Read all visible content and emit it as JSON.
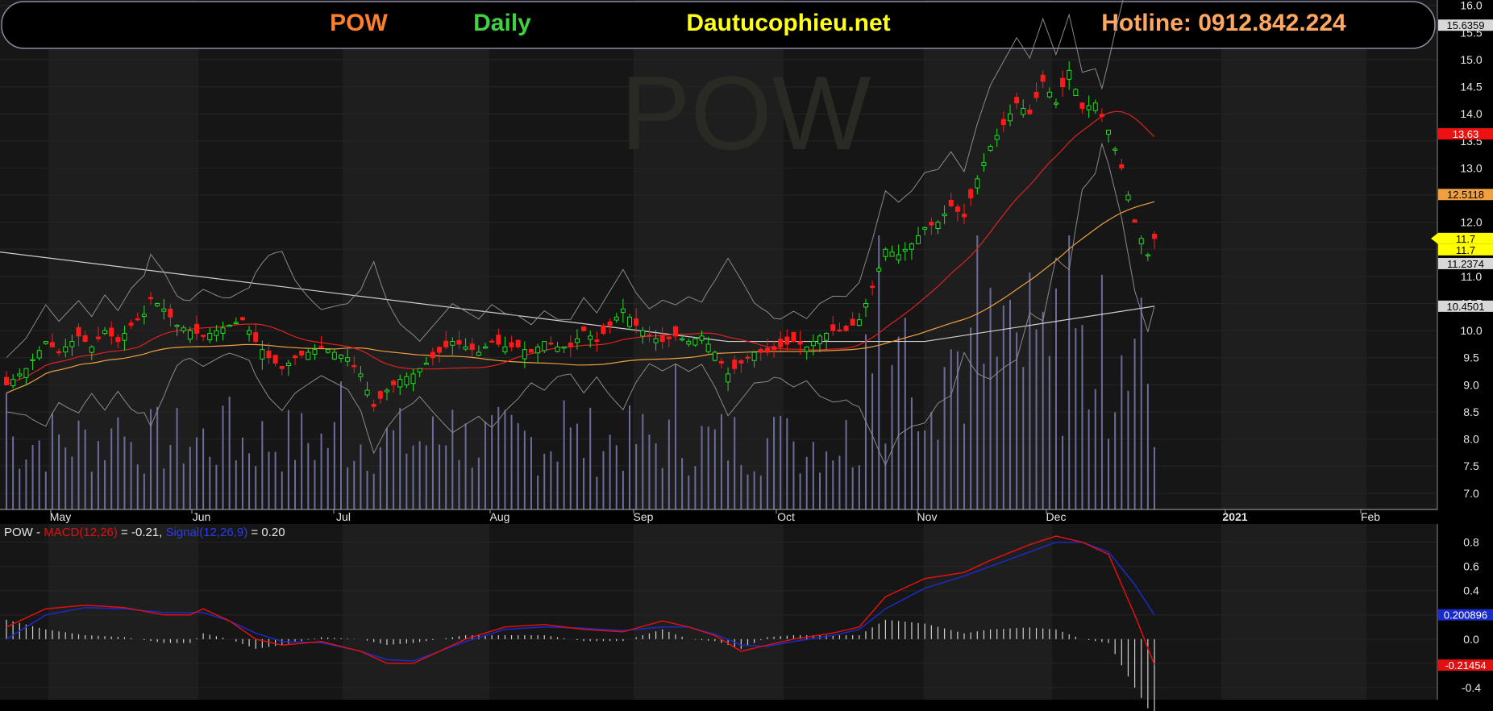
{
  "header": {
    "symbol": "POW",
    "period": "Daily",
    "site": "Dautucophieu.net",
    "hotline": "Hotline: 0912.842.224"
  },
  "colors": {
    "symbol": "#ff7f2a",
    "period": "#3fd13f",
    "site": "#ffff1a",
    "hotline": "#ffa860",
    "up_candle": "#22dd22",
    "down_candle": "#ff1a1a",
    "macd_line": "#e01010",
    "signal_line": "#1a2cc8",
    "volume": "#6c6c9a"
  },
  "watermark": "POW",
  "chart_data": [
    {
      "type": "candlestick",
      "ticker": "POW",
      "ylim": [
        6.7,
        16.1
      ],
      "y_ticks": [
        "7.0",
        "7.5",
        "8.0",
        "8.5",
        "9.0",
        "9.5",
        "10.0",
        "10.5",
        "11.0",
        "11.5",
        "12.0",
        "12.5",
        "13.0",
        "13.5",
        "14.0",
        "14.5",
        "15.0",
        "15.5",
        "16.0"
      ],
      "x_labels": [
        "May",
        "Jun",
        "Jul",
        "Aug",
        "Sep",
        "Oct",
        "Nov",
        "Dec",
        "2021",
        "Feb"
      ],
      "price_tags": [
        {
          "label": "15.6359",
          "value": 15.6359,
          "bg": "#d8d8d8",
          "fg": "#000000"
        },
        {
          "label": "13.63",
          "value": 13.63,
          "bg": "#ee1111",
          "fg": "#ffffff"
        },
        {
          "label": "12.5118",
          "value": 12.5118,
          "bg": "#f0a040",
          "fg": "#000000"
        },
        {
          "label": "11.7",
          "value": 11.7,
          "bg": "#ffff00",
          "fg": "#000000"
        },
        {
          "label": "11.7",
          "value": 11.7,
          "bg": "#ffff00",
          "fg": "#000000"
        },
        {
          "label": "11.2374",
          "value": 11.2374,
          "bg": "#d8d8d8",
          "fg": "#000000"
        },
        {
          "label": "10.4501",
          "value": 10.4501,
          "bg": "#d8d8d8",
          "fg": "#000000"
        }
      ],
      "ohlc_description": "Daily candles from late April 2020 to early Feb 2021",
      "close_path": [
        [
          0,
          9.0
        ],
        [
          3,
          9.3
        ],
        [
          6,
          9.8
        ],
        [
          8,
          9.6
        ],
        [
          11,
          9.9
        ],
        [
          13,
          9.7
        ],
        [
          15,
          10.0
        ],
        [
          17,
          9.8
        ],
        [
          19,
          10.1
        ],
        [
          21,
          10.3
        ],
        [
          22,
          10.6
        ],
        [
          24,
          10.4
        ],
        [
          26,
          10.1
        ],
        [
          28,
          10.0
        ],
        [
          30,
          9.9
        ],
        [
          32,
          10.0
        ],
        [
          34,
          10.1
        ],
        [
          36,
          10.2
        ],
        [
          38,
          9.8
        ],
        [
          40,
          9.5
        ],
        [
          42,
          9.3
        ],
        [
          44,
          9.5
        ],
        [
          46,
          9.6
        ],
        [
          48,
          9.7
        ],
        [
          50,
          9.6
        ],
        [
          52,
          9.5
        ],
        [
          54,
          9.2
        ],
        [
          56,
          8.6
        ],
        [
          58,
          8.9
        ],
        [
          60,
          9.1
        ],
        [
          62,
          9.2
        ],
        [
          64,
          9.4
        ],
        [
          66,
          9.6
        ],
        [
          68,
          9.8
        ],
        [
          70,
          9.7
        ],
        [
          72,
          9.6
        ],
        [
          74,
          9.8
        ],
        [
          76,
          9.7
        ],
        [
          78,
          9.7
        ],
        [
          80,
          9.6
        ],
        [
          82,
          9.8
        ],
        [
          84,
          9.7
        ],
        [
          86,
          9.7
        ],
        [
          88,
          10.0
        ],
        [
          90,
          9.8
        ],
        [
          92,
          10.1
        ],
        [
          94,
          10.4
        ],
        [
          96,
          10.1
        ],
        [
          98,
          9.9
        ],
        [
          100,
          9.8
        ],
        [
          102,
          9.9
        ],
        [
          104,
          9.8
        ],
        [
          106,
          9.9
        ],
        [
          108,
          9.6
        ],
        [
          110,
          9.2
        ],
        [
          112,
          9.4
        ],
        [
          114,
          9.6
        ],
        [
          116,
          9.6
        ],
        [
          118,
          9.7
        ],
        [
          120,
          9.8
        ],
        [
          122,
          9.7
        ],
        [
          124,
          9.9
        ],
        [
          126,
          10.0
        ],
        [
          128,
          10.0
        ],
        [
          130,
          10.2
        ],
        [
          132,
          10.8
        ],
        [
          134,
          11.5
        ],
        [
          136,
          11.4
        ],
        [
          138,
          11.6
        ],
        [
          140,
          11.9
        ],
        [
          142,
          12.0
        ],
        [
          144,
          12.3
        ],
        [
          146,
          12.1
        ],
        [
          148,
          12.8
        ],
        [
          150,
          13.4
        ],
        [
          152,
          13.8
        ],
        [
          154,
          14.2
        ],
        [
          156,
          14.0
        ],
        [
          158,
          14.6
        ],
        [
          160,
          14.2
        ],
        [
          162,
          14.8
        ],
        [
          164,
          14.1
        ],
        [
          166,
          14.2
        ],
        [
          168,
          13.7
        ],
        [
          170,
          13.0
        ],
        [
          172,
          12.0
        ],
        [
          174,
          11.4
        ],
        [
          175,
          11.7
        ]
      ]
    },
    {
      "type": "line",
      "name": "MACD panel",
      "series_labels": {
        "ticker": "POW",
        "sep": " - ",
        "macd": "MACD(12,26)",
        "macd_val": " = -0.21, ",
        "signal": "Signal(12,26,9)",
        "signal_val": " = 0.20"
      },
      "ylim": [
        -0.5,
        0.95
      ],
      "y_ticks": [
        "0.8",
        "0.6",
        "0.4",
        "0.2",
        "0.0",
        "-0.2",
        "-0.4"
      ],
      "tags": [
        {
          "label": "0.200896",
          "value": 0.2009,
          "bg": "#1a2cc8",
          "fg": "#ffffff"
        },
        {
          "label": "-0.21454",
          "value": -0.2145,
          "bg": "#e01010",
          "fg": "#ffffff"
        }
      ],
      "macd": [
        [
          0,
          0.1
        ],
        [
          6,
          0.25
        ],
        [
          12,
          0.28
        ],
        [
          18,
          0.26
        ],
        [
          24,
          0.2
        ],
        [
          28,
          0.2
        ],
        [
          30,
          0.25
        ],
        [
          34,
          0.15
        ],
        [
          38,
          0.0
        ],
        [
          42,
          -0.05
        ],
        [
          48,
          -0.02
        ],
        [
          54,
          -0.1
        ],
        [
          58,
          -0.2
        ],
        [
          62,
          -0.2
        ],
        [
          66,
          -0.1
        ],
        [
          70,
          0.0
        ],
        [
          76,
          0.1
        ],
        [
          82,
          0.12
        ],
        [
          88,
          0.08
        ],
        [
          94,
          0.06
        ],
        [
          100,
          0.15
        ],
        [
          104,
          0.1
        ],
        [
          108,
          0.03
        ],
        [
          112,
          -0.1
        ],
        [
          116,
          -0.05
        ],
        [
          120,
          0.0
        ],
        [
          126,
          0.05
        ],
        [
          130,
          0.1
        ],
        [
          134,
          0.35
        ],
        [
          140,
          0.5
        ],
        [
          146,
          0.55
        ],
        [
          150,
          0.65
        ],
        [
          156,
          0.78
        ],
        [
          160,
          0.85
        ],
        [
          164,
          0.8
        ],
        [
          168,
          0.7
        ],
        [
          172,
          0.2
        ],
        [
          175,
          -0.21
        ]
      ],
      "signal": [
        [
          0,
          0.0
        ],
        [
          6,
          0.2
        ],
        [
          12,
          0.26
        ],
        [
          18,
          0.25
        ],
        [
          24,
          0.22
        ],
        [
          30,
          0.22
        ],
        [
          34,
          0.15
        ],
        [
          38,
          0.05
        ],
        [
          42,
          -0.02
        ],
        [
          48,
          -0.03
        ],
        [
          54,
          -0.1
        ],
        [
          58,
          -0.17
        ],
        [
          62,
          -0.18
        ],
        [
          66,
          -0.1
        ],
        [
          70,
          -0.02
        ],
        [
          76,
          0.08
        ],
        [
          82,
          0.1
        ],
        [
          88,
          0.09
        ],
        [
          94,
          0.07
        ],
        [
          100,
          0.1
        ],
        [
          104,
          0.1
        ],
        [
          108,
          0.04
        ],
        [
          112,
          -0.05
        ],
        [
          116,
          -0.06
        ],
        [
          120,
          -0.02
        ],
        [
          126,
          0.03
        ],
        [
          130,
          0.08
        ],
        [
          134,
          0.25
        ],
        [
          140,
          0.42
        ],
        [
          146,
          0.52
        ],
        [
          150,
          0.6
        ],
        [
          156,
          0.72
        ],
        [
          160,
          0.8
        ],
        [
          164,
          0.8
        ],
        [
          168,
          0.72
        ],
        [
          172,
          0.45
        ],
        [
          175,
          0.2
        ]
      ]
    }
  ]
}
